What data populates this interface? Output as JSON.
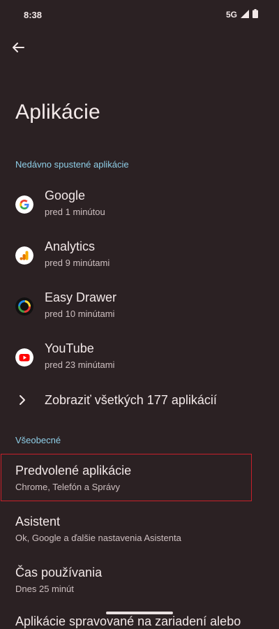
{
  "status_bar": {
    "time": "8:38",
    "network": "5G"
  },
  "page": {
    "title": "Aplikácie"
  },
  "recent": {
    "header": "Nedávno spustené aplikácie",
    "apps": [
      {
        "name": "Google",
        "time": "pred 1 minútou",
        "icon": "google-icon"
      },
      {
        "name": "Analytics",
        "time": "pred 9 minútami",
        "icon": "analytics-icon"
      },
      {
        "name": "Easy Drawer",
        "time": "pred 10 minútami",
        "icon": "easy-drawer-icon"
      },
      {
        "name": "YouTube",
        "time": "pred 23 minútami",
        "icon": "youtube-icon"
      }
    ],
    "show_all": "Zobraziť všetkých 177 aplikácií"
  },
  "general": {
    "header": "Všeobecné",
    "items": [
      {
        "title": "Predvolené aplikácie",
        "subtitle": "Chrome, Telefón a Správy"
      },
      {
        "title": "Asistent",
        "subtitle": "Ok, Google a ďalšie nastavenia Asistenta"
      },
      {
        "title": "Čas používania",
        "subtitle": "Dnes 25 minút"
      }
    ],
    "partial_item": "Aplikácie spravované na zariadení alebo"
  },
  "colors": {
    "background": "#2b2123",
    "accent": "#8fcfe8",
    "highlight": "#c8202a"
  }
}
